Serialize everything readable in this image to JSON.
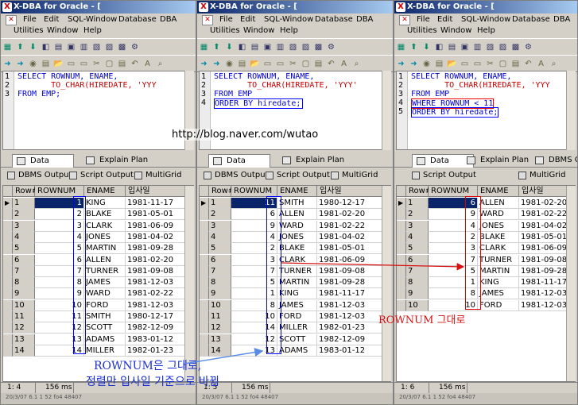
{
  "windows": [
    {
      "title": "X-DBA for Oracle - [",
      "menu": [
        "File",
        "Edit",
        "SQL-Window",
        "Database",
        "DBA",
        "Utilities",
        "Window",
        "Help"
      ],
      "sql": [
        "SELECT ROWNUM, ENAME,",
        "       TO_CHAR(HIREDATE, 'YYY",
        "FROM EMP;"
      ],
      "tabs": [
        "Data",
        "Explain Plan"
      ],
      "subtabs": [
        "DBMS Output",
        "Script Output",
        "MultiGrid"
      ],
      "headers": [
        "Row#",
        "ROWNUM",
        "ENAME",
        "입사일"
      ],
      "rows": [
        [
          "1",
          "1",
          "KING",
          "1981-11-17"
        ],
        [
          "2",
          "2",
          "BLAKE",
          "1981-05-01"
        ],
        [
          "3",
          "3",
          "CLARK",
          "1981-06-09"
        ],
        [
          "4",
          "4",
          "JONES",
          "1981-04-02"
        ],
        [
          "5",
          "5",
          "MARTIN",
          "1981-09-28"
        ],
        [
          "6",
          "6",
          "ALLEN",
          "1981-02-20"
        ],
        [
          "7",
          "7",
          "TURNER",
          "1981-09-08"
        ],
        [
          "8",
          "8",
          "JAMES",
          "1981-12-03"
        ],
        [
          "9",
          "9",
          "WARD",
          "1981-02-22"
        ],
        [
          "10",
          "10",
          "FORD",
          "1981-12-03"
        ],
        [
          "11",
          "11",
          "SMITH",
          "1980-12-17"
        ],
        [
          "12",
          "12",
          "SCOTT",
          "1982-12-09"
        ],
        [
          "13",
          "13",
          "ADAMS",
          "1983-01-12"
        ],
        [
          "14",
          "14",
          "MILLER",
          "1982-01-23"
        ]
      ],
      "status": [
        "1: 4",
        "156 ms"
      ],
      "statbot": "20/3/07 6.1 1 52 fo4 48407"
    },
    {
      "title": "X-DBA for Oracle - [",
      "menu": [
        "File",
        "Edit",
        "SQL-Window",
        "Database",
        "DBA",
        "Utilities",
        "Window",
        "Help"
      ],
      "sql": [
        "SELECT ROWNUM, ENAME,",
        "       TO_CHAR(HIREDATE, 'YYY'",
        "FROM EMP",
        "ORDER BY hiredate;"
      ],
      "tabs": [
        "Data",
        "Explain Plan"
      ],
      "subtabs": [
        "DBMS Output",
        "Script Output",
        "MultiGrid"
      ],
      "headers": [
        "Row#",
        "ROWNUM",
        "ENAME",
        "입사일"
      ],
      "rows": [
        [
          "1",
          "11",
          "SMITH",
          "1980-12-17"
        ],
        [
          "2",
          "6",
          "ALLEN",
          "1981-02-20"
        ],
        [
          "3",
          "9",
          "WARD",
          "1981-02-22"
        ],
        [
          "4",
          "4",
          "JONES",
          "1981-04-02"
        ],
        [
          "5",
          "2",
          "BLAKE",
          "1981-05-01"
        ],
        [
          "6",
          "3",
          "CLARK",
          "1981-06-09"
        ],
        [
          "7",
          "7",
          "TURNER",
          "1981-09-08"
        ],
        [
          "8",
          "5",
          "MARTIN",
          "1981-09-28"
        ],
        [
          "9",
          "1",
          "KING",
          "1981-11-17"
        ],
        [
          "10",
          "8",
          "JAMES",
          "1981-12-03"
        ],
        [
          "11",
          "10",
          "FORD",
          "1981-12-03"
        ],
        [
          "12",
          "14",
          "MILLER",
          "1982-01-23"
        ],
        [
          "13",
          "12",
          "SCOTT",
          "1982-12-09"
        ],
        [
          "14",
          "13",
          "ADAMS",
          "1983-01-12"
        ]
      ],
      "status": [
        "1: 5",
        "156 ms"
      ],
      "statbot": "20/3/07 6.1 1 52 fo4 48407"
    },
    {
      "title": "X-DBA for Oracle - [",
      "menu": [
        "File",
        "Edit",
        "SQL-Window",
        "Database",
        "DBA",
        "Utilities",
        "Window",
        "Help"
      ],
      "sql": [
        "SELECT ROWNUM, ENAME,",
        "       TO_CHAR(HIREDATE, 'YYY",
        "FROM EMP",
        "WHERE ROWNUM < 11",
        "ORDER BY hiredate;"
      ],
      "tabs": [
        "Data",
        "Explain Plan",
        "DBMS Output"
      ],
      "subtabs": [
        "Script Output",
        "MultiGrid"
      ],
      "headers": [
        "Row#",
        "ROWNUM",
        "ENAME",
        "입사일"
      ],
      "rows": [
        [
          "1",
          "6",
          "ALLEN",
          "1981-02-20"
        ],
        [
          "2",
          "9",
          "WARD",
          "1981-02-22"
        ],
        [
          "3",
          "4",
          "JONES",
          "1981-04-02"
        ],
        [
          "4",
          "2",
          "BLAKE",
          "1981-05-01"
        ],
        [
          "5",
          "3",
          "CLARK",
          "1981-06-09"
        ],
        [
          "6",
          "7",
          "TURNER",
          "1981-09-08"
        ],
        [
          "7",
          "5",
          "MARTIN",
          "1981-09-28"
        ],
        [
          "8",
          "1",
          "KING",
          "1981-11-17"
        ],
        [
          "9",
          "8",
          "JAMES",
          "1981-12-03"
        ],
        [
          "10",
          "10",
          "FORD",
          "1981-12-03"
        ]
      ],
      "status": [
        "1: 6",
        "156 ms"
      ],
      "statbot": "20/3/07 6.1 1 52 fo4 48407"
    }
  ],
  "annotations": {
    "url": "http://blog.naver.com/wutao",
    "blue_line1": "ROWNUM은 그대로,",
    "blue_line2": "정렬만 입사일 기준으로 바뀜",
    "red_label": "ROWNUM 그대로"
  },
  "colors": {
    "title_start": "#0a246a",
    "keyword": "#0000cc",
    "highlight_blue": "#0000ff",
    "highlight_red": "#e00000",
    "annotation_blue": "#1a2fd0",
    "annotation_red": "#d81010"
  }
}
